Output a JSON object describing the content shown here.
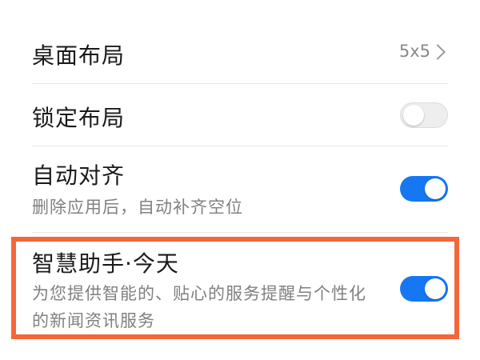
{
  "settings": {
    "items": [
      {
        "title": "桌面布局",
        "value": "5x5"
      },
      {
        "title": "锁定布局",
        "toggle": false
      },
      {
        "title": "自动对齐",
        "subtitle": "删除应用后，自动补齐空位",
        "toggle": true
      },
      {
        "title": "智慧助手·今天",
        "subtitle": "为您提供智能的、贴心的服务提醒与个性化的新闻资讯服务",
        "toggle": true
      }
    ]
  },
  "colors": {
    "switch_on": "#1677f3",
    "switch_off": "#eeeeee",
    "highlight": "#f4673a"
  },
  "icons": {
    "chevron": "chevron-right-icon"
  }
}
